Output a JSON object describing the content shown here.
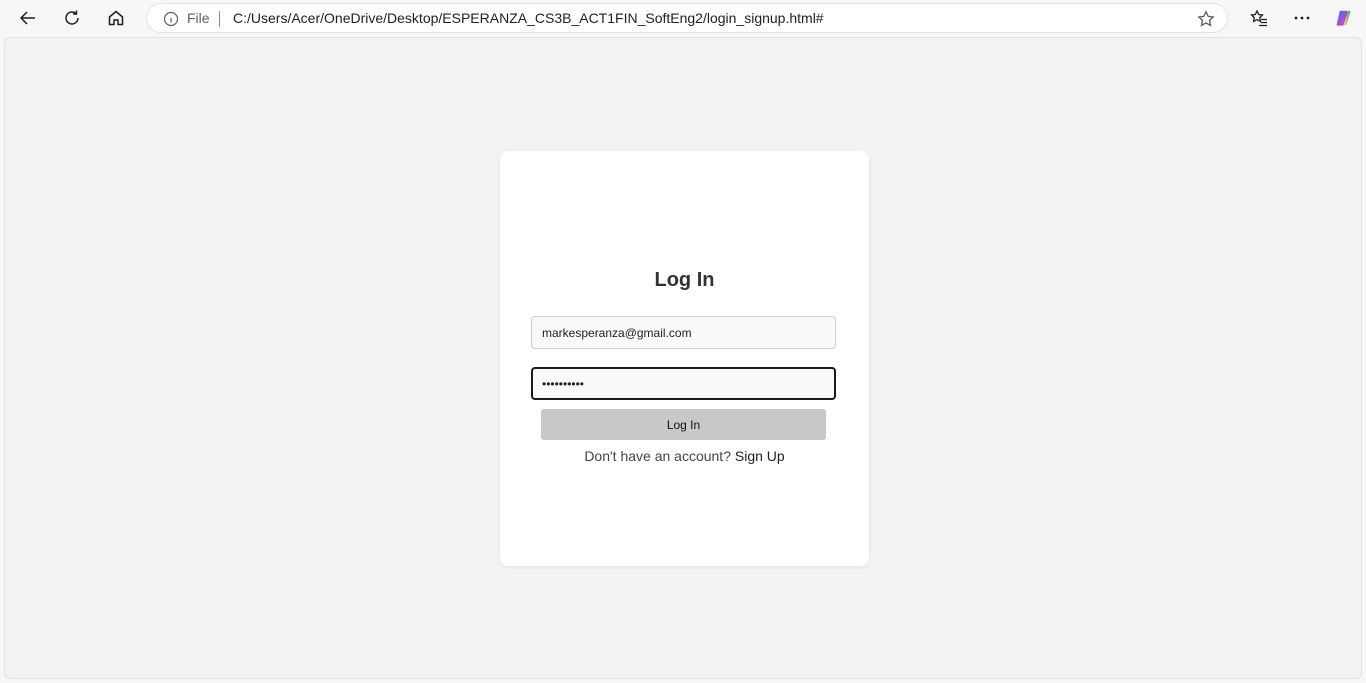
{
  "browser": {
    "scheme": "File",
    "url": "C:/Users/Acer/OneDrive/Desktop/ESPERANZA_CS3B_ACT1FIN_SoftEng2/login_signup.html#"
  },
  "login": {
    "title": "Log In",
    "email_value": "markesperanza@gmail.com",
    "password_value": "••••••••••",
    "submit_label": "Log In",
    "signup_prompt": "Don't have an account?",
    "signup_link": "Sign Up"
  },
  "icons": {
    "back": "arrow-left-icon",
    "reload": "reload-icon",
    "home": "home-icon",
    "info": "info-icon",
    "favorite": "star-icon",
    "favorites": "favorites-icon",
    "menu": "more-icon",
    "copilot": "copilot-icon"
  }
}
